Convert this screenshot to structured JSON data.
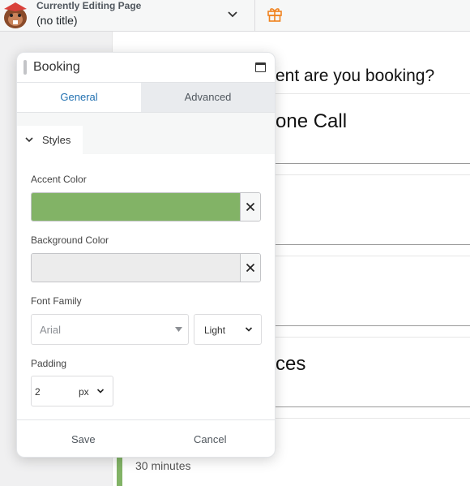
{
  "topbar": {
    "kicker": "Currently Editing Page",
    "page_title": "(no title)",
    "logo_icon": "beaver-logo-icon",
    "dropdown_icon": "chevron-down-icon",
    "gift_icon": "gift-icon",
    "gift_color": "#f0821e"
  },
  "canvas": {
    "question": "ent are you booking?",
    "service_1": "one Call",
    "service_4": "ces",
    "duration": "30 minutes",
    "accent": "#82b366"
  },
  "panel": {
    "title": "Booking",
    "maximize_icon": "maximize-icon",
    "tabs": [
      {
        "label": "General"
      },
      {
        "label": "Advanced"
      }
    ],
    "section": {
      "label": "Styles",
      "icon": "chevron-down-icon"
    },
    "accent_color": {
      "label": "Accent Color",
      "value": "#82b366",
      "clear_icon": "close-icon"
    },
    "background_color": {
      "label": "Background Color",
      "value": "#ececec",
      "clear_icon": "close-icon"
    },
    "font_family": {
      "label": "Font Family",
      "family": "Arial",
      "weight": "Light"
    },
    "padding": {
      "label": "Padding",
      "value": "2",
      "unit": "px"
    },
    "footer": {
      "save": "Save",
      "cancel": "Cancel"
    }
  }
}
